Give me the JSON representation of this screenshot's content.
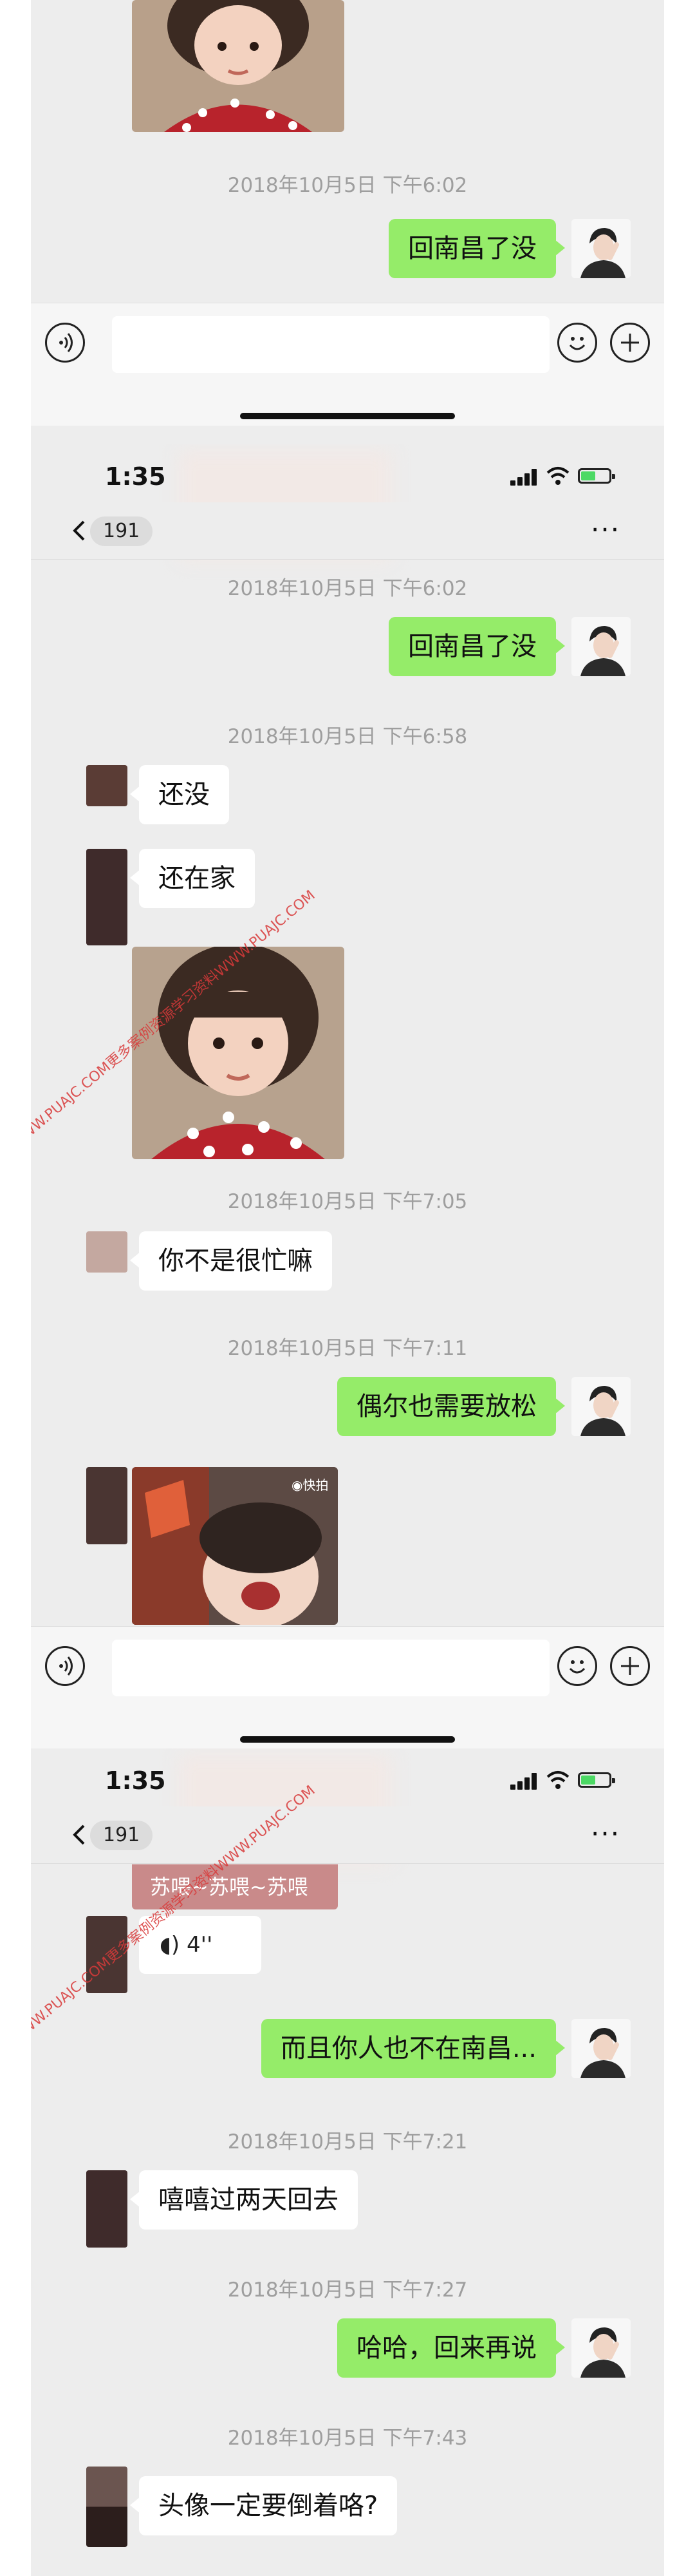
{
  "status_bar": {
    "time": "1:35"
  },
  "nav": {
    "unread_count": "191",
    "more": "···"
  },
  "segment1": {
    "timestamp_1": "2018年10月5日 下午6:02",
    "msg_me_1": "回南昌了没"
  },
  "segment2": {
    "timestamp_1": "2018年10月5日 下午6:02",
    "msg_me_1": "回南昌了没",
    "timestamp_2": "2018年10月5日 下午6:58",
    "msg_them_1": "还没",
    "msg_them_2": "还在家",
    "timestamp_3": "2018年10月5日 下午7:05",
    "msg_them_3": "你不是很忙嘛",
    "timestamp_4": "2018年10月5日 下午7:11",
    "msg_me_2": "偶尔也需要放松",
    "gif_tag": "快拍"
  },
  "segment3": {
    "caption_text": "苏喂~苏喂~苏喂",
    "voice_duration": "4''",
    "msg_me_1": "而且你人也不在南昌...",
    "timestamp_1": "2018年10月5日 下午7:21",
    "msg_them_1": "嘻嘻过两天回去",
    "timestamp_2": "2018年10月5日 下午7:27",
    "msg_me_2": "哈哈，回来再说",
    "timestamp_3": "2018年10月5日 下午7:43",
    "msg_them_2": "头像一定要倒着咯?"
  },
  "watermark": {
    "text_a": "WWW.PUAJC.COM更多案例资源学习资料WWW.PUAJC.COM",
    "text_b": "WWW.PUAJC.COM更多案例资源学习资料WWW.PUAJC.COM"
  },
  "colors": {
    "chat_bg": "#ededed",
    "bubble_me": "#95ec69",
    "bubble_them": "#ffffff",
    "timestamp": "#9e9e9e",
    "watermark": "#d93a3a"
  },
  "icons": [
    "voice-icon",
    "emoji-icon",
    "plus-icon",
    "back-icon",
    "signal-icon",
    "wifi-icon",
    "battery-icon",
    "more-icon"
  ]
}
